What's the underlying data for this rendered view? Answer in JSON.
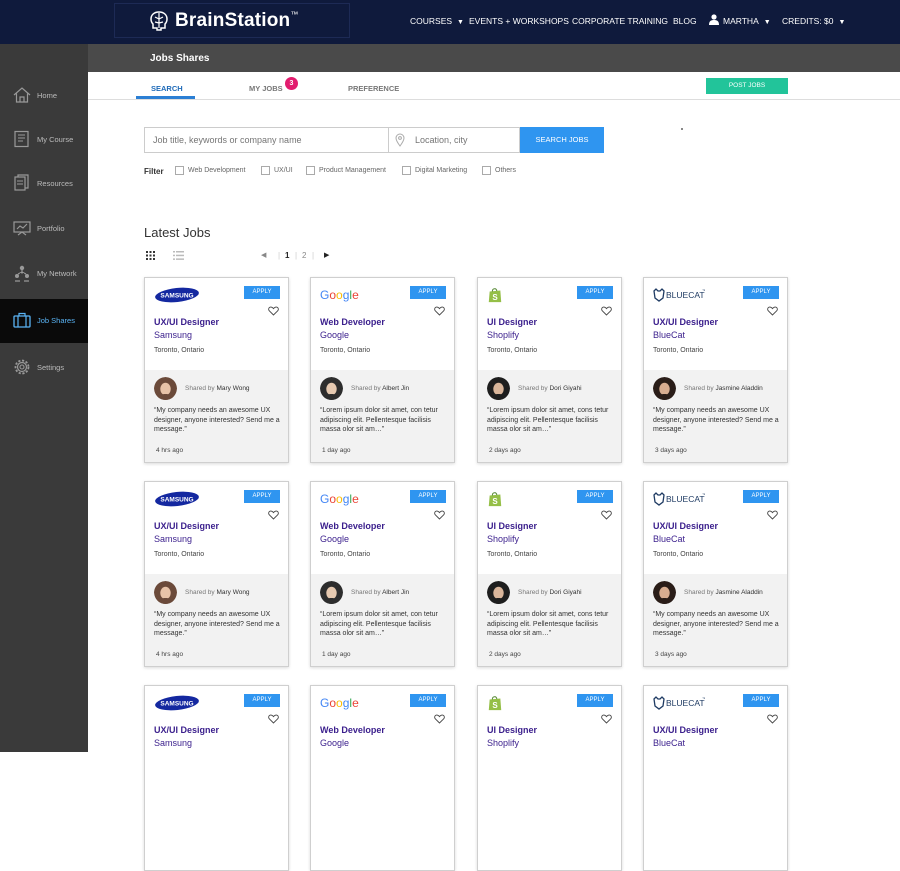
{
  "app": {
    "logo_text": "BrainStation",
    "logo_tm": "™",
    "nav": [
      {
        "label": "COURSES",
        "caret": "▼"
      },
      {
        "label": "EVENTS + WORKSHOPS"
      },
      {
        "label": "CORPORATE TRAINING"
      },
      {
        "label": "BLOG"
      },
      {
        "label": "MARTHA",
        "caret": "▼"
      },
      {
        "label": "CREDITS: $0",
        "caret": "▼"
      }
    ]
  },
  "sidebar": {
    "items": [
      {
        "label": "Home",
        "icon": "home-icon"
      },
      {
        "label": "My Course",
        "icon": "course-icon"
      },
      {
        "label": "Resources",
        "icon": "resources-icon"
      },
      {
        "label": "Portfolio",
        "icon": "portfolio-icon"
      },
      {
        "label": "My Network",
        "icon": "network-icon"
      },
      {
        "label": "Job Shares",
        "icon": "briefcase-icon",
        "active": true
      },
      {
        "label": "Settings",
        "icon": "gear-icon"
      }
    ]
  },
  "page": {
    "title": "Jobs Shares",
    "tabs": [
      {
        "label": "SEARCH",
        "active": true
      },
      {
        "label": "MY JOBS",
        "badge": "3"
      },
      {
        "label": "PREFERENCE"
      }
    ],
    "post_button": "POST JOBS"
  },
  "search": {
    "keyword_placeholder": "Job title, keywords or company name",
    "location_placeholder": "Location, city",
    "button": "SEARCH JOBS",
    "filter_label": "Filter",
    "filters": [
      "Web Development",
      "UX/UI",
      "Product Management",
      "Digital Marketing",
      "Others"
    ]
  },
  "latest": {
    "title": "Latest Jobs",
    "pager": {
      "prev": "◀",
      "pages": [
        "1",
        "2"
      ],
      "next": "▶"
    }
  },
  "jobs": [
    {
      "company": "Samsung",
      "logo_text": "SAMSUNG",
      "title": "UX/UI Designer",
      "location": "Toronto, Ontario",
      "shared_prefix": "Shared by",
      "shared_by": "Mary Wong",
      "quote": "“My company needs an awesome UX designer, anyone interested? Send me a message.”",
      "time": "4 hrs ago",
      "apply": "APPLY"
    },
    {
      "company": "Google",
      "logo_text": "Google",
      "title": "Web Developer",
      "location": "Toronto, Ontario",
      "shared_prefix": "Shared by",
      "shared_by": "Albert Jin",
      "quote": "“Lorem ipsum dolor sit amet, con tetur adipiscing elit. Pellentesque facilisis massa olor sit am…”",
      "time": "1 day ago",
      "apply": "APPLY"
    },
    {
      "company": "Shoplify",
      "logo_text": "S",
      "title": "UI Designer",
      "location": "Toronto, Ontario",
      "shared_prefix": "Shared by",
      "shared_by": "Dori Giyahi",
      "quote": "“Lorem ipsum dolor sit amet, cons tetur adipiscing elit. Pellentesque facilisis massa olor sit am…”",
      "time": "2 days ago",
      "apply": "APPLY"
    },
    {
      "company": "BlueCat",
      "logo_text": "BLUECAT",
      "logo_tm": "™",
      "title": "UX/UI Designer",
      "location": "Toronto, Ontario",
      "shared_prefix": "Shared by",
      "shared_by": "Jasmine Aladdin",
      "quote": "“My company needs an awesome UX designer, anyone interested? Send me a message.”",
      "time": "3 days ago",
      "apply": "APPLY"
    },
    {
      "company": "Samsung",
      "logo_text": "SAMSUNG",
      "title": "UX/UI Designer",
      "location": "Toronto, Ontario",
      "shared_prefix": "Shared by",
      "shared_by": "Mary Wong",
      "quote": "“My company needs an awesome UX designer, anyone interested? Send me a message.”",
      "time": "4 hrs ago",
      "apply": "APPLY"
    },
    {
      "company": "Google",
      "logo_text": "Google",
      "title": "Web Developer",
      "location": "Toronto, Ontario",
      "shared_prefix": "Shared by",
      "shared_by": "Albert Jin",
      "quote": "“Lorem ipsum dolor sit amet, con tetur adipiscing elit. Pellentesque facilisis massa olor sit am…”",
      "time": "1 day ago",
      "apply": "APPLY"
    },
    {
      "company": "Shoplify",
      "logo_text": "S",
      "title": "UI Designer",
      "location": "Toronto, Ontario",
      "shared_prefix": "Shared by",
      "shared_by": "Dori Giyahi",
      "quote": "“Lorem ipsum dolor sit amet, cons tetur adipiscing elit. Pellentesque facilisis massa olor sit am…”",
      "time": "2 days ago",
      "apply": "APPLY"
    },
    {
      "company": "BlueCat",
      "logo_text": "BLUECAT",
      "logo_tm": "™",
      "title": "UX/UI Designer",
      "location": "Toronto, Ontario",
      "shared_prefix": "Shared by",
      "shared_by": "Jasmine Aladdin",
      "quote": "“My company needs an awesome UX designer, anyone interested? Send me a message.”",
      "time": "3 days ago",
      "apply": "APPLY"
    },
    {
      "company": "Samsung",
      "logo_text": "SAMSUNG",
      "title": "UX/UI Designer",
      "location": "",
      "shared_prefix": "",
      "shared_by": "",
      "quote": "",
      "time": "",
      "apply": "APPLY"
    },
    {
      "company": "Google",
      "logo_text": "Google",
      "title": "Web Developer",
      "location": "",
      "shared_prefix": "",
      "shared_by": "",
      "quote": "",
      "time": "",
      "apply": "APPLY"
    },
    {
      "company": "Shoplify",
      "logo_text": "S",
      "title": "UI Designer",
      "location": "",
      "shared_prefix": "",
      "shared_by": "",
      "quote": "",
      "time": "",
      "apply": "APPLY"
    },
    {
      "company": "BlueCat",
      "logo_text": "BLUECAT",
      "logo_tm": "™",
      "title": "UX/UI Designer",
      "location": "",
      "shared_prefix": "",
      "shared_by": "",
      "quote": "",
      "time": "",
      "apply": "APPLY"
    }
  ],
  "colors": {
    "topbar": "#0f1a3c",
    "accent": "#2f95f0",
    "post_button": "#22c49a",
    "job_title": "#3a1e8c",
    "badge": "#e21c6e"
  }
}
